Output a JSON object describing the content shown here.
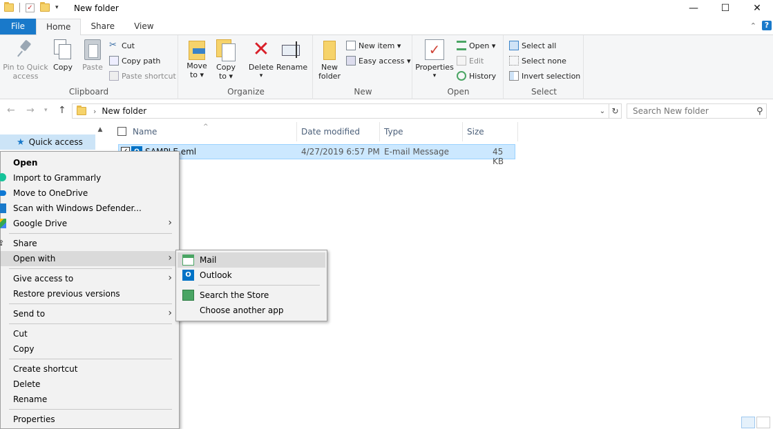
{
  "window": {
    "title": "New folder",
    "controls": {
      "minimize": "—",
      "maximize": "☐",
      "close": "✕"
    }
  },
  "ribbon_tabs": {
    "file": "File",
    "home": "Home",
    "share": "Share",
    "view": "View"
  },
  "ribbon": {
    "clipboard": {
      "label": "Clipboard",
      "pin": "Pin to Quick access",
      "pin_l1": "Pin to Quick",
      "pin_l2": "access",
      "copy": "Copy",
      "paste": "Paste",
      "cut": "Cut",
      "copy_path": "Copy path",
      "paste_shortcut": "Paste shortcut"
    },
    "organize": {
      "label": "Organize",
      "move_l1": "Move",
      "move_l2": "to ▾",
      "copy_l1": "Copy",
      "copy_l2": "to ▾",
      "delete": "Delete",
      "rename": "Rename"
    },
    "new": {
      "label": "New",
      "new_folder_l1": "New",
      "new_folder_l2": "folder",
      "new_item": "New item ▾",
      "easy_access": "Easy access ▾"
    },
    "open": {
      "label": "Open",
      "properties": "Properties",
      "open": "Open ▾",
      "edit": "Edit",
      "history": "History"
    },
    "select": {
      "label": "Select",
      "select_all": "Select all",
      "select_none": "Select none",
      "invert": "Invert selection"
    }
  },
  "address": {
    "path": "New folder",
    "search_placeholder": "Search New folder"
  },
  "nav_pane": {
    "quick_access": "Quick access"
  },
  "file_list": {
    "columns": {
      "name": "Name",
      "date": "Date modified",
      "type": "Type",
      "size": "Size"
    },
    "rows": [
      {
        "name": "SAMPLE.eml",
        "date": "4/27/2019 6:57 PM",
        "type": "E-mail Message",
        "size": "45 KB"
      }
    ]
  },
  "context_menu": {
    "items": {
      "open": "Open",
      "grammarly": "Import to Grammarly",
      "onedrive": "Move to OneDrive",
      "defender": "Scan with Windows Defender...",
      "gdrive": "Google Drive",
      "share": "Share",
      "open_with": "Open with",
      "give_access": "Give access to",
      "restore": "Restore previous versions",
      "send_to": "Send to",
      "cut": "Cut",
      "copy": "Copy",
      "create_shortcut": "Create shortcut",
      "delete": "Delete",
      "rename": "Rename",
      "properties": "Properties"
    }
  },
  "open_with_submenu": {
    "mail": "Mail",
    "outlook": "Outlook",
    "store": "Search the Store",
    "choose": "Choose another app"
  },
  "colors": {
    "accent": "#1979ca",
    "selection": "#cce8ff",
    "menu_bg": "#f2f2f2",
    "menu_hover": "#dadada",
    "delete_red": "#d9202a"
  }
}
